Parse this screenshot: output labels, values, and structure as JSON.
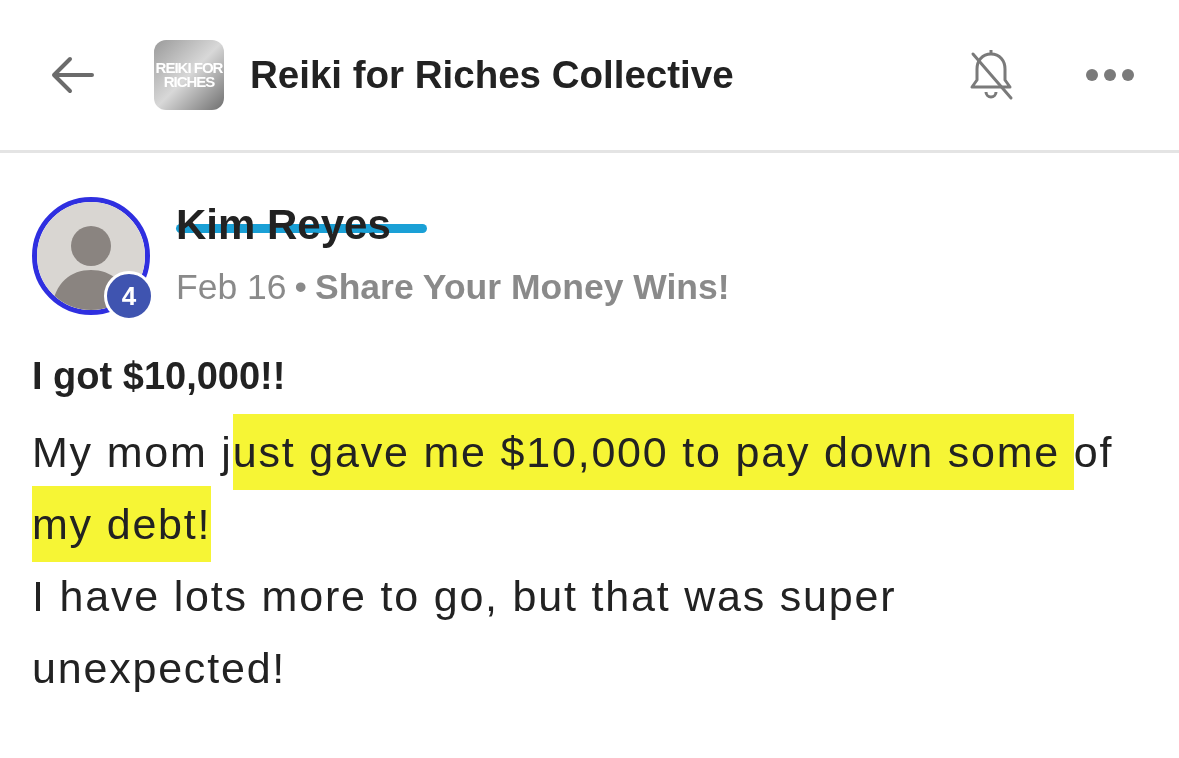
{
  "header": {
    "logo_text": "REIKI FOR RICHES",
    "title": "Reiki for Riches Collective",
    "notifications_muted": true
  },
  "post": {
    "author": {
      "name": "Kim Reyes",
      "struck_out": true,
      "level_badge": "4"
    },
    "date": "Feb 16",
    "separator": "•",
    "category": "Share Your Money Wins!",
    "title": "I got $10,000!!",
    "paragraphs": [
      [
        {
          "text": "My mom j",
          "highlighted": false
        },
        {
          "text": "ust gave me $10,000 to pay down some ",
          "highlighted": true
        },
        {
          "text": "of ",
          "highlighted": false
        },
        {
          "text": "my debt!",
          "highlighted": true
        }
      ],
      [
        {
          "text": "I have lots more to go, but that was super unexpected!",
          "highlighted": false
        }
      ]
    ]
  }
}
